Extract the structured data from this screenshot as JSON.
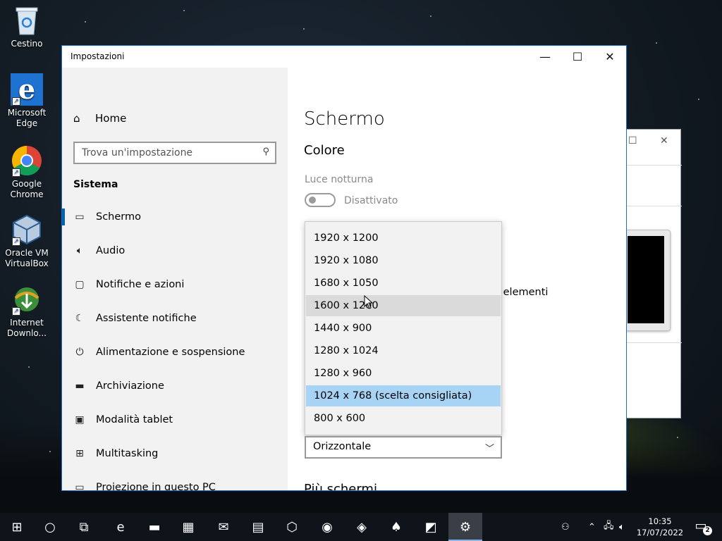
{
  "desktop": {
    "icons": [
      {
        "label": "Cestino"
      },
      {
        "label": "Microsoft Edge"
      },
      {
        "label": "Google Chrome"
      },
      {
        "label": "Oracle VM VirtualBox"
      },
      {
        "label": "Internet Downlo..."
      }
    ]
  },
  "window": {
    "title": "Impostazioni",
    "minimize_glyph": "—",
    "maximize_glyph": "☐",
    "close_glyph": "✕"
  },
  "sidebar": {
    "home_label": "Home",
    "search_placeholder": "Trova un'impostazione",
    "section_title": "Sistema",
    "items": [
      {
        "label": "Schermo",
        "icon": "monitor-icon",
        "glyph": "▭",
        "active": true
      },
      {
        "label": "Audio",
        "icon": "speaker-icon",
        "glyph": "🔈︎",
        "active": false
      },
      {
        "label": "Notifiche e azioni",
        "icon": "message-icon",
        "glyph": "▢",
        "active": false
      },
      {
        "label": "Assistente notifiche",
        "icon": "moon-icon",
        "glyph": "☾",
        "active": false
      },
      {
        "label": "Alimentazione e sospensione",
        "icon": "power-icon",
        "glyph": "⏻",
        "active": false
      },
      {
        "label": "Archiviazione",
        "icon": "storage-icon",
        "glyph": "▬",
        "active": false
      },
      {
        "label": "Modalità tablet",
        "icon": "tablet-icon",
        "glyph": "▣",
        "active": false
      },
      {
        "label": "Multitasking",
        "icon": "multitasking-icon",
        "glyph": "⊞",
        "active": false
      },
      {
        "label": "Proiezione in questo PC",
        "icon": "projection-icon",
        "glyph": "▭",
        "active": false
      }
    ]
  },
  "content": {
    "page_title": "Schermo",
    "color_title": "Colore",
    "night_light_label": "Luce notturna",
    "night_light_state": "Disattivato",
    "partial_text": "i elementi",
    "resolution_options": [
      {
        "label": "1920 x 1200",
        "state": "normal"
      },
      {
        "label": "1920 x 1080",
        "state": "normal"
      },
      {
        "label": "1680 x 1050",
        "state": "normal"
      },
      {
        "label": "1600 x 1200",
        "state": "hover"
      },
      {
        "label": "1440 x 900",
        "state": "normal"
      },
      {
        "label": "1280 x 1024",
        "state": "normal"
      },
      {
        "label": "1280 x 960",
        "state": "normal"
      },
      {
        "label": "1024 x 768 (scelta consigliata)",
        "state": "selected"
      },
      {
        "label": "800 x 600",
        "state": "normal"
      }
    ],
    "orientation_value": "Orizzontale",
    "more_screens_title": "Più schermi"
  },
  "taskbar": {
    "apps": [
      {
        "name": "start-button",
        "glyph": "⊞"
      },
      {
        "name": "cortana-button",
        "glyph": "○"
      },
      {
        "name": "task-view-button",
        "glyph": "⧉"
      },
      {
        "name": "edge-taskbar",
        "glyph": "e"
      },
      {
        "name": "explorer-taskbar",
        "glyph": "▬"
      },
      {
        "name": "store-taskbar",
        "glyph": "▦"
      },
      {
        "name": "mail-taskbar",
        "glyph": "✉"
      },
      {
        "name": "app-taskbar",
        "glyph": "▤"
      },
      {
        "name": "virtualbox-taskbar",
        "glyph": "⬡"
      },
      {
        "name": "chrome-taskbar",
        "glyph": "◉"
      },
      {
        "name": "idm-taskbar",
        "glyph": "◈"
      },
      {
        "name": "solitaire-taskbar",
        "glyph": "♠"
      },
      {
        "name": "app2-taskbar",
        "glyph": "◩"
      },
      {
        "name": "settings-taskbar",
        "glyph": "⚙"
      }
    ],
    "time": "10:35",
    "date": "17/07/2022",
    "notification_count": "2"
  },
  "colors": {
    "accent": "#0063b1",
    "selected_option": "#a7d3f5",
    "hover_option": "#dadada",
    "taskbar": "#0f131a"
  }
}
